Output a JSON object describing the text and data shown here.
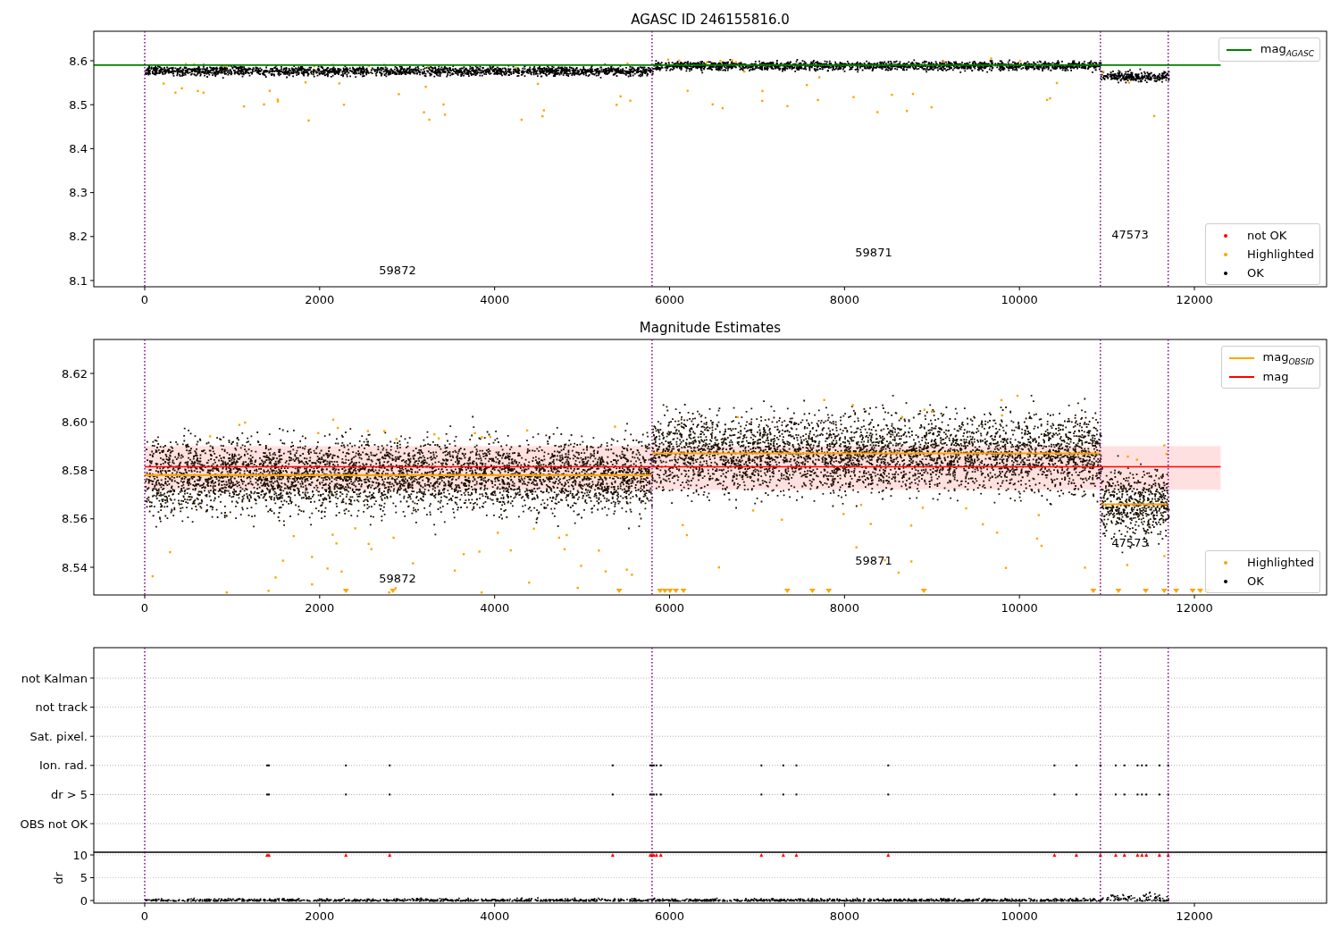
{
  "figure": {
    "panels": [
      {
        "kind": "mag",
        "title": "AGASC ID 246155816.0",
        "yticks": [
          "8.6",
          "8.5",
          "8.4",
          "8.3",
          "8.2",
          "8.1"
        ],
        "xticks": [
          "0",
          "2000",
          "4000",
          "6000",
          "8000",
          "10000",
          "12000"
        ],
        "obs_labels": [
          "59872",
          "59871",
          "47573"
        ],
        "legend_top": [
          {
            "label": "mag$_{AGASC}$",
            "kind": "line",
            "color": "#008000"
          }
        ],
        "legend_bottom": [
          {
            "label": "not OK",
            "kind": "dot",
            "color": "#ff0000"
          },
          {
            "label": "Highlighted",
            "kind": "dot",
            "color": "#ffa500"
          },
          {
            "label": "OK",
            "kind": "dot",
            "color": "#000000"
          }
        ]
      },
      {
        "kind": "estimates",
        "title": "Magnitude Estimates",
        "yticks": [
          "8.62",
          "8.60",
          "8.58",
          "8.56",
          "8.54"
        ],
        "xticks": [
          "0",
          "2000",
          "4000",
          "6000",
          "8000",
          "10000",
          "12000"
        ],
        "obs_labels": [
          "59872",
          "59871",
          "47573"
        ],
        "legend_top": [
          {
            "label": "mag$_{OBSID}$",
            "kind": "line",
            "color": "#ffa500"
          },
          {
            "label": "mag",
            "kind": "line",
            "color": "#ff0000"
          }
        ],
        "legend_bottom": [
          {
            "label": "Highlighted",
            "kind": "dot",
            "color": "#ffa500"
          },
          {
            "label": "OK",
            "kind": "dot",
            "color": "#000000"
          }
        ]
      },
      {
        "kind": "flags",
        "categories": [
          "not Kalman",
          "not track",
          "Sat. pixel.",
          "Ion. rad.",
          "dr > 5",
          "OBS not OK"
        ]
      },
      {
        "kind": "dr",
        "ylabel": "dr",
        "yticks": [
          "10",
          "5",
          "0"
        ],
        "xticks": [
          "0",
          "2000",
          "4000",
          "6000",
          "8000",
          "10000",
          "12000"
        ]
      }
    ]
  }
}
